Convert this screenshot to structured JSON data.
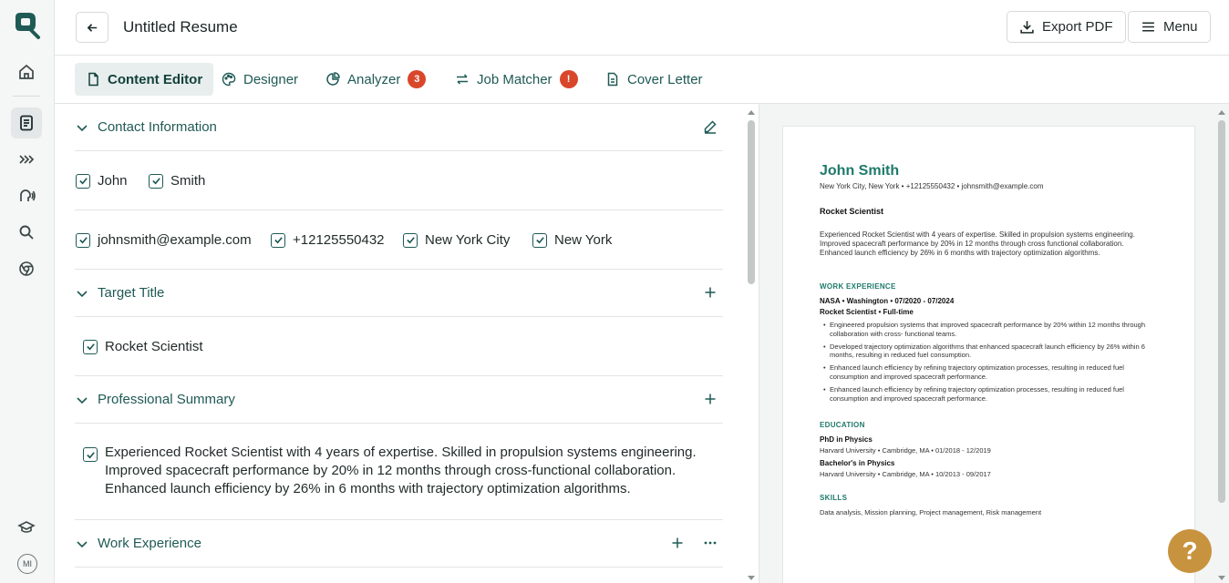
{
  "header": {
    "title": "Untitled Resume",
    "export_label": "Export PDF",
    "menu_label": "Menu"
  },
  "tabs": [
    {
      "label": "Content Editor",
      "active": true
    },
    {
      "label": "Designer"
    },
    {
      "label": "Analyzer",
      "badge": "3"
    },
    {
      "label": "Job Matcher",
      "badge": "!"
    },
    {
      "label": "Cover Letter"
    }
  ],
  "sidebar": {
    "avatar_initials": "MI"
  },
  "editor": {
    "contact": {
      "title": "Contact Information",
      "first_name": "John",
      "last_name": "Smith",
      "email": "johnsmith@example.com",
      "phone": "+12125550432",
      "city": "New York City",
      "state": "New York"
    },
    "target_title": {
      "title": "Target Title",
      "value": "Rocket Scientist"
    },
    "summary": {
      "title": "Professional Summary",
      "text": "Experienced Rocket Scientist with 4 years of expertise. Skilled in propulsion systems engineering. Improved spacecraft performance by 20% in 12 months through cross-functional collaboration. Enhanced launch efficiency by 26% in 6 months with trajectory optimization algorithms."
    },
    "work": {
      "title": "Work Experience"
    }
  },
  "resume": {
    "name": "John Smith",
    "contact_line": "New York City, New York • +12125550432 • johnsmith@example.com",
    "title": "Rocket Scientist",
    "summary": "Experienced Rocket Scientist with 4 years of expertise. Skilled in propulsion systems engineering. Improved spacecraft performance by 20% in 12 months through cross functional collaboration. Enhanced launch efficiency by 26% in 6 months with trajectory optimization algorithms.",
    "work_heading": "WORK EXPERIENCE",
    "job_line": "NASA • Washington • 07/2020 - 07/2024",
    "job_role": "Rocket Scientist • Full-time",
    "bullets": [
      "Engineered propulsion systems that improved spacecraft performance by 20% within 12 months through collaboration with cross- functional teams.",
      "Developed trajectory optimization algorithms that enhanced spacecraft launch efficiency by 26% within 6 months, resulting in reduced fuel consumption.",
      "Enhanced launch efficiency by refining trajectory optimization processes, resulting in reduced fuel consumption and improved spacecraft performance.",
      "Enhanced launch efficiency by refining trajectory optimization processes, resulting in reduced fuel consumption and improved spacecraft performance."
    ],
    "education_heading": "EDUCATION",
    "edu": [
      {
        "degree": "PhD in Physics",
        "detail": "Harvard University • Cambridge, MA • 01/2018 - 12/2019"
      },
      {
        "degree": "Bachelor's in Physics",
        "detail": "Harvard University • Cambridge, MA • 10/2013 - 09/2017"
      }
    ],
    "skills_heading": "SKILLS",
    "skills": "Data analysis, Mission planning, Project management, Risk management"
  },
  "help_label": "?",
  "colors": {
    "accent": "#1f5a55",
    "brand_green": "#1e7a6b",
    "badge_red": "#d9472b",
    "help_gold": "#c8933f"
  }
}
